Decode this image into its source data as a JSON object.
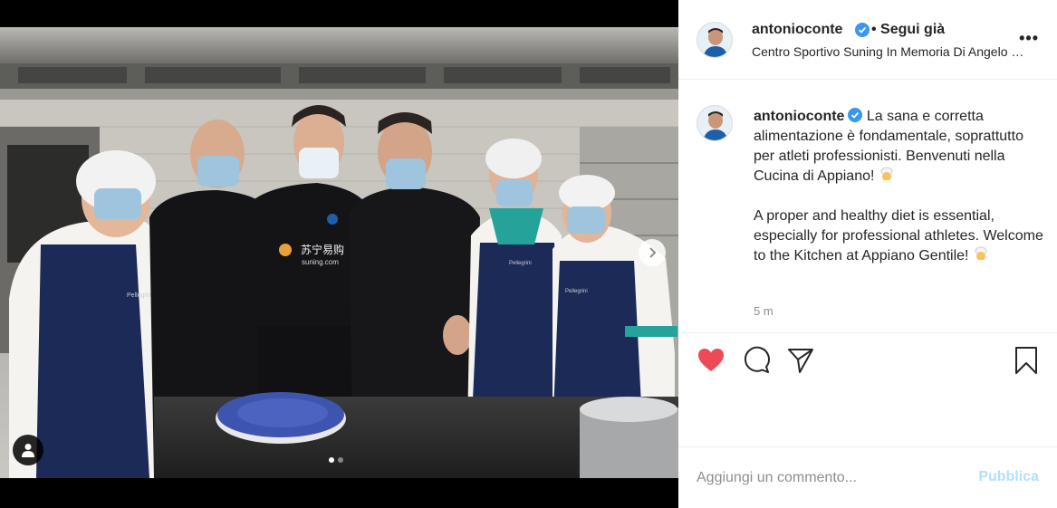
{
  "post": {
    "username": "antonioconte",
    "follow_status": "• Segui già",
    "location": "Centro Sportivo Suning In Memoria Di Angelo Moratti",
    "caption_it_1": "La sana e corretta alimentazione è fondamentale, soprattutto per atleti professionisti. Benvenuti nella Cucina di Appiano!",
    "caption_en_1": "A proper and healthy diet is essential, especially for professional athletes. Welcome to the Kitchen at Appiano Gentile!",
    "time_ago": "5 m",
    "more_label": "•••"
  },
  "media": {
    "carousel_index": 0,
    "carousel_count": 2,
    "next_icon": "chevron-right-icon",
    "tag_icon": "user-tag-icon",
    "shirt_text": "苏宁易购",
    "shirt_subtext": "suning.com",
    "apron_text": "Pellegrini"
  },
  "actions": {
    "icons": [
      "heart-filled-icon",
      "comment-icon",
      "share-icon",
      "bookmark-icon"
    ],
    "liked": true
  },
  "comment": {
    "placeholder": "Aggiungi un commento...",
    "publish_label": "Pubblica"
  },
  "colors": {
    "like_red": "#ed4956",
    "verified_blue": "#3897f0",
    "publish_disabled": "#b2dffc",
    "meta_gray": "#8e8e8e"
  }
}
